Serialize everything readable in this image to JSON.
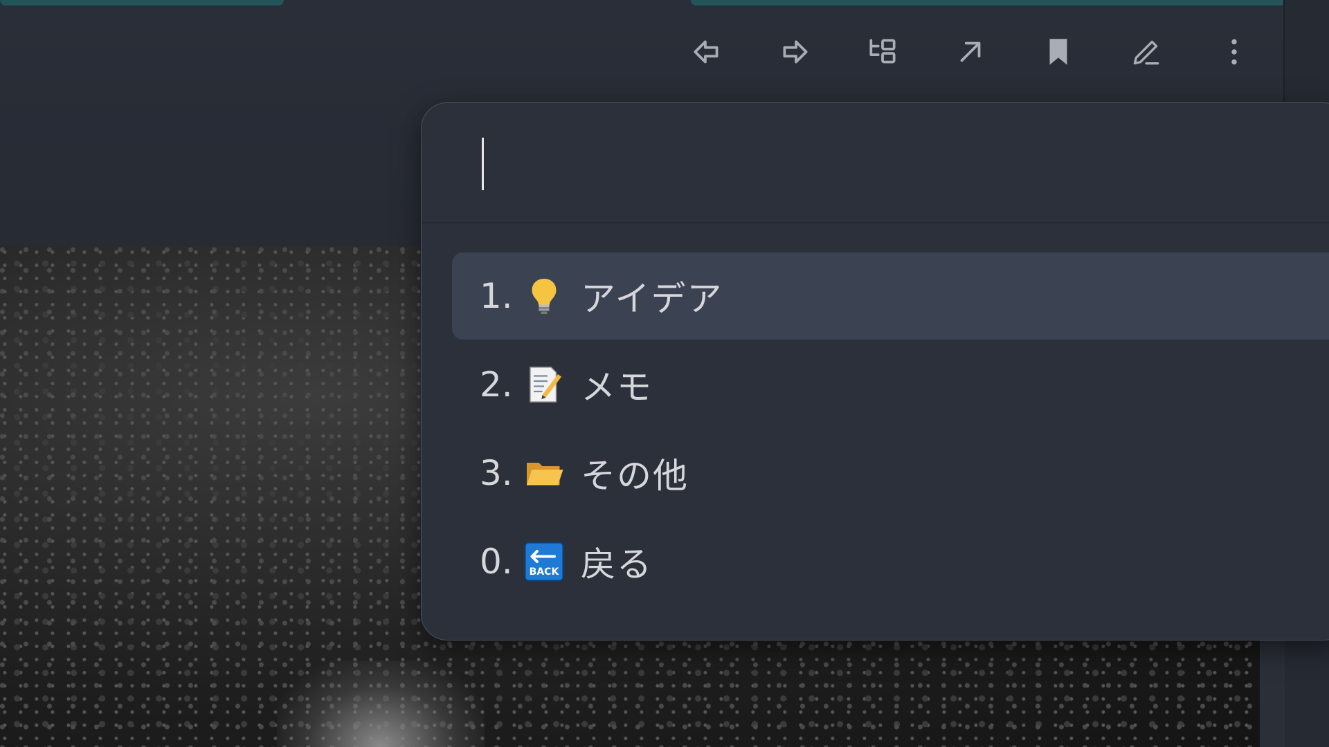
{
  "toolbar": {
    "buttons": [
      {
        "name": "navigate-back",
        "icon": "arrow-left-icon"
      },
      {
        "name": "navigate-forward",
        "icon": "arrow-right-icon"
      },
      {
        "name": "reveal-in-tree",
        "icon": "tree-structure-icon"
      },
      {
        "name": "open-in-new",
        "icon": "arrow-up-right-icon"
      },
      {
        "name": "bookmark",
        "icon": "bookmark-icon"
      },
      {
        "name": "edit",
        "icon": "pencil-icon"
      },
      {
        "name": "more-options",
        "icon": "more-vertical-icon"
      }
    ]
  },
  "prompt": {
    "input_value": "",
    "placeholder": ""
  },
  "suggestions": [
    {
      "number": "1.",
      "icon": "lightbulb-icon",
      "label": "アイデア",
      "selected": true
    },
    {
      "number": "2.",
      "icon": "memo-icon",
      "label": "メモ",
      "selected": false
    },
    {
      "number": "3.",
      "icon": "folder-icon",
      "label": "その他",
      "selected": false
    },
    {
      "number": "0.",
      "icon": "back-icon",
      "label": "戻る",
      "selected": false
    }
  ],
  "colors": {
    "background": "#262a33",
    "modal": "#2b303b",
    "selected_row": "#3b4252",
    "tab_accent": "#22555a",
    "icon": "#a9adb6"
  }
}
